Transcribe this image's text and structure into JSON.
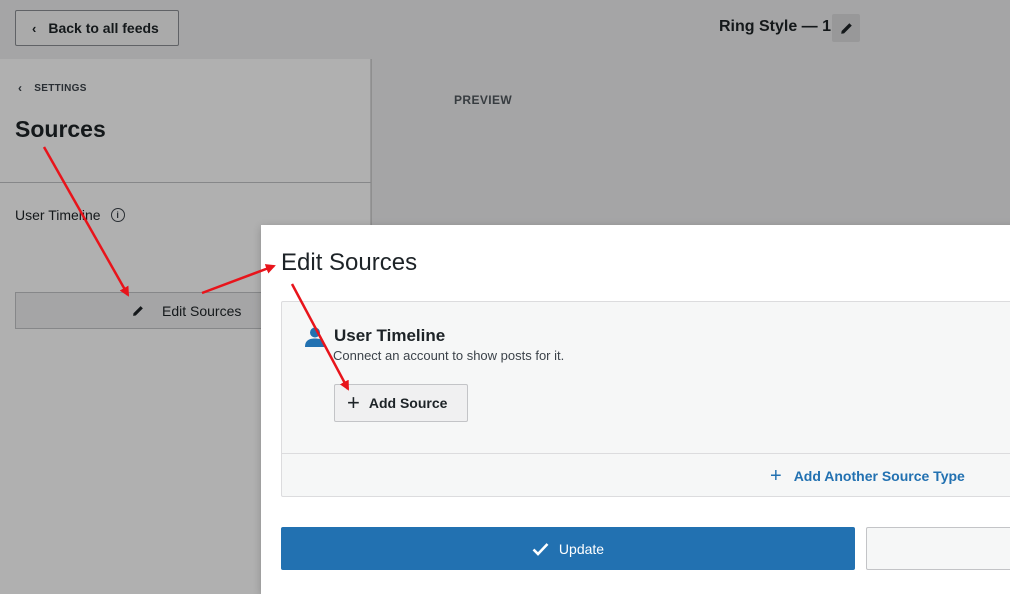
{
  "topbar": {
    "back_label": "Back to all feeds",
    "feed_title": "Ring Style — 1"
  },
  "sidebar": {
    "crumb": "SETTINGS",
    "title": "Sources",
    "source_name": "User Timeline",
    "edit_label": "Edit Sources"
  },
  "preview": {
    "label": "PREVIEW"
  },
  "modal": {
    "title": "Edit Sources",
    "source_type_title": "User Timeline",
    "source_type_desc": "Connect an account to show posts for it.",
    "add_source_label": "Add Source",
    "add_type_label": "Add Another Source Type",
    "update_label": "Update"
  },
  "colors": {
    "primary": "#2271b1",
    "arrow": "#e8141b",
    "user_icon": "#2271b1"
  }
}
